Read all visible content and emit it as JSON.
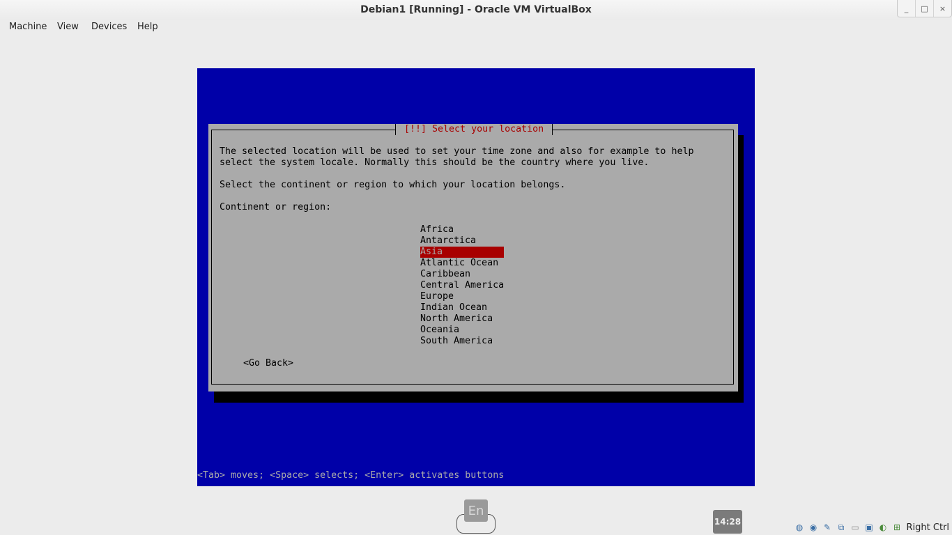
{
  "window": {
    "title": "Debian1 [Running] - Oracle VM VirtualBox",
    "controls": {
      "minimize": "_",
      "maximize": "□",
      "close": "×"
    }
  },
  "menu": [
    "Machine",
    "View",
    "Devices",
    "Help"
  ],
  "installer": {
    "dialog_title": "[!!] Select your location",
    "description_line1": "The selected location will be used to set your time zone and also for example to help",
    "description_line2": "select the system locale. Normally this should be the country where you live.",
    "prompt": "Select the continent or region to which your location belongs.",
    "list_label": "Continent or region:",
    "regions": [
      "Africa",
      "Antarctica",
      "Asia",
      "Atlantic Ocean",
      "Caribbean",
      "Central America",
      "Europe",
      "Indian Ocean",
      "North America",
      "Oceania",
      "South America"
    ],
    "selected_region": "Asia",
    "go_back": "<Go Back>",
    "help_line": "<Tab> moves; <Space> selects; <Enter> activates buttons"
  },
  "taskbar": {
    "language": "En",
    "clock": "14:28"
  },
  "statusbar": {
    "icons": [
      "hard-disk-icon",
      "optical-drive-icon",
      "usb-icon",
      "network-icon",
      "shared-folders-icon",
      "display-icon",
      "video-capture-icon",
      "cpu-icon"
    ],
    "host_key": "Right Ctrl"
  },
  "colors": {
    "vm_background": "#0000a8",
    "dialog_background": "#aaaaaa",
    "title_red": "#a80000",
    "selection": "#a80000"
  }
}
